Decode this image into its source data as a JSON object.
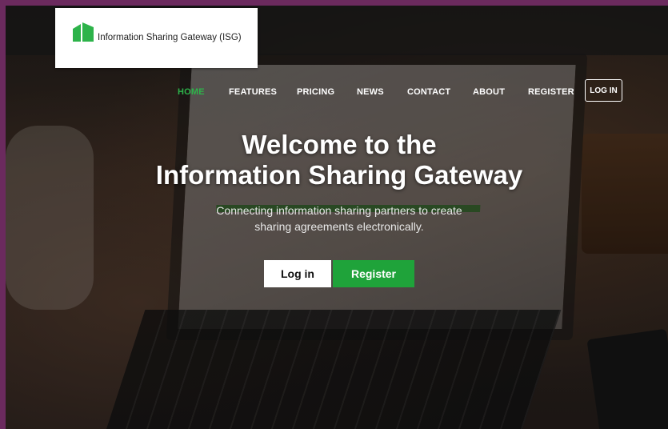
{
  "brand": {
    "name": "Information Sharing Gateway (ISG)",
    "logo_icon": "isg-logo-icon",
    "logo_color": "#2db34a"
  },
  "nav": {
    "items": [
      {
        "label": "HOME",
        "active": true
      },
      {
        "label": "FEATURES"
      },
      {
        "label": "PRICING"
      },
      {
        "label": "NEWS"
      },
      {
        "label": "CONTACT"
      },
      {
        "label": "ABOUT"
      },
      {
        "label": "REGISTER"
      }
    ],
    "login_label": "LOG IN",
    "active_color": "#2db34a"
  },
  "hero": {
    "title_line1": "Welcome to the",
    "title_line2": "Information Sharing Gateway",
    "subtitle_line1": "Connecting information sharing partners to create",
    "subtitle_line2": "sharing agreements electronically.",
    "login_button": "Log in",
    "register_button": "Register",
    "register_color": "#1fa33a"
  }
}
